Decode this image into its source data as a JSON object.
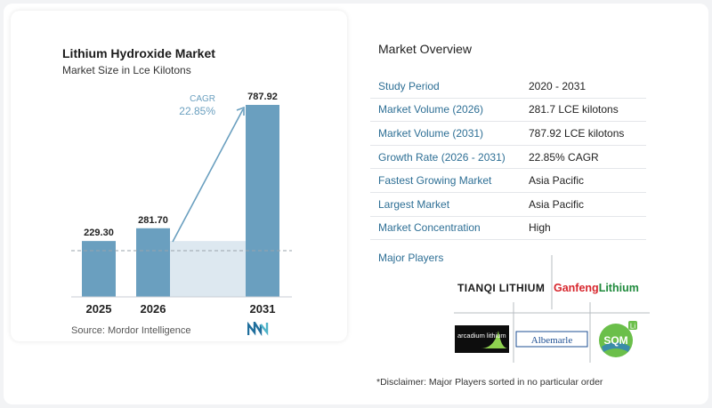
{
  "chart": {
    "title": "Lithium Hydroxide Market",
    "subtitle": "Market Size in Lce Kilotons",
    "cagr_label": "CAGR",
    "cagr_value": "22.85%",
    "source": "Source:  Mordor Intelligence"
  },
  "chart_data": {
    "type": "bar",
    "title": "Lithium Hydroxide Market",
    "subtitle": "Market Size in Lce Kilotons",
    "categories": [
      "2025",
      "2026",
      "2031"
    ],
    "values": [
      229.3,
      281.7,
      787.92
    ],
    "value_labels": [
      "229.30",
      "281.70",
      "787.92"
    ],
    "annotation": "CAGR 22.85%",
    "xlabel": "",
    "ylabel": "",
    "grid": false,
    "colors": {
      "bar": "#6a9fbf",
      "bar_light": "#dde8f0",
      "arrow": "#6a9fbf",
      "dashed_line": "#9aa3ab"
    }
  },
  "overview": {
    "title": "Market Overview",
    "rows": [
      {
        "key": "Study Period",
        "value": "2020 - 2031"
      },
      {
        "key": "Market Volume (2026)",
        "value": "281.7 LCE kilotons"
      },
      {
        "key": "Market Volume (2031)",
        "value": "787.92 LCE kilotons"
      },
      {
        "key": "Growth Rate (2026 - 2031)",
        "value": "22.85% CAGR"
      },
      {
        "key": "Fastest Growing Market",
        "value": "Asia Pacific"
      },
      {
        "key": "Largest Market",
        "value": "Asia Pacific"
      },
      {
        "key": "Market Concentration",
        "value": "High"
      }
    ]
  },
  "players": {
    "title": "Major Players",
    "logos": [
      "TIANQI LITHIUM",
      "GanfengLithium",
      "arcadium lithium",
      "Albemarle",
      "SQM"
    ],
    "disclaimer": "*Disclaimer: Major Players sorted in no particular order"
  },
  "colors": {
    "accent_text": "#2e6f95",
    "bar": "#6a9fbf",
    "bar_light": "#dde8f0",
    "ganfeng_red": "#d7262d",
    "ganfeng_green": "#1f8a3c",
    "albemarle_blue": "#1e4f93",
    "sqm_green": "#6bbf4a"
  }
}
